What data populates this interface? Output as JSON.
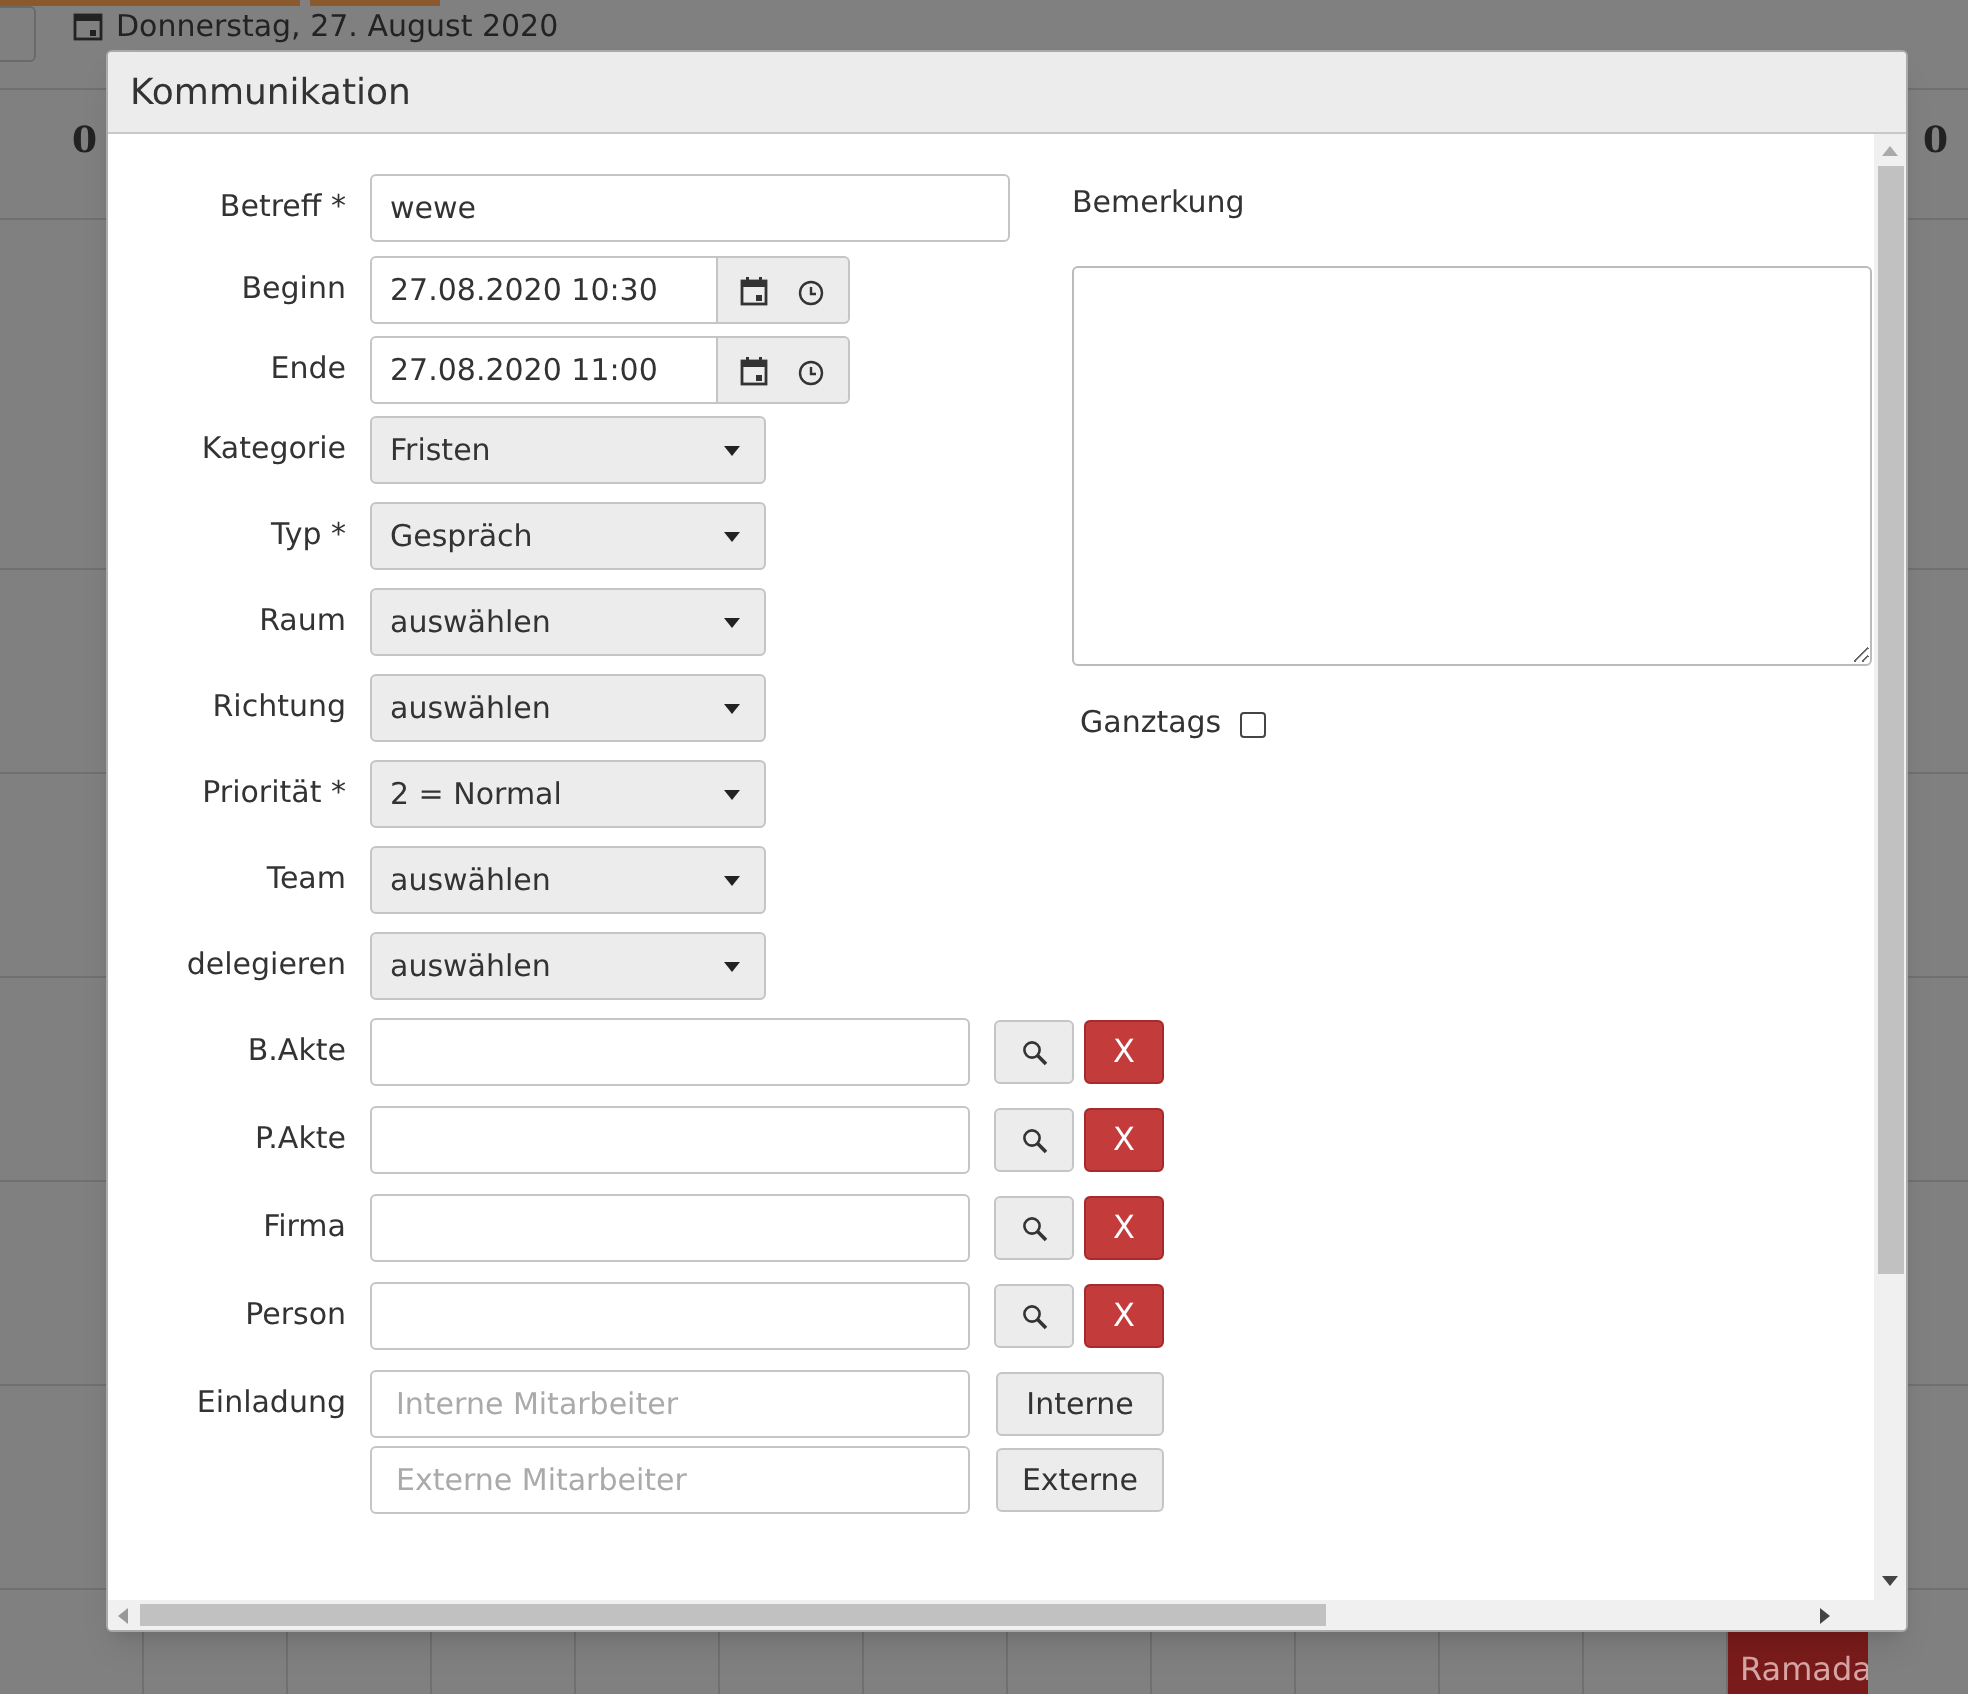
{
  "background": {
    "date": "Donnerstag, 27. August 2020",
    "column_headers": [
      "0",
      "0"
    ],
    "event": "Ramada"
  },
  "dialog": {
    "title": "Kommunikation",
    "fields": [
      {
        "kind": "text",
        "label": "Betreff *",
        "value": "wewe"
      },
      {
        "kind": "datetime",
        "label": "Beginn",
        "value": "27.08.2020 10:30"
      },
      {
        "kind": "datetime",
        "label": "Ende",
        "value": "27.08.2020 11:00"
      },
      {
        "kind": "select",
        "label": "Kategorie",
        "value": "Fristen"
      },
      {
        "kind": "select",
        "label": "Typ *",
        "value": "Gespräch"
      },
      {
        "kind": "select",
        "label": "Raum",
        "value": "auswählen"
      },
      {
        "kind": "select",
        "label": "Richtung",
        "value": "auswählen"
      },
      {
        "kind": "select",
        "label": "Priorität *",
        "value": "2 = Normal"
      },
      {
        "kind": "select",
        "label": "Team",
        "value": "auswählen"
      },
      {
        "kind": "select",
        "label": "delegieren",
        "value": "auswählen"
      },
      {
        "kind": "lookup",
        "label": "B.Akte",
        "clear": "X"
      },
      {
        "kind": "lookup",
        "label": "P.Akte",
        "clear": "X"
      },
      {
        "kind": "lookup",
        "label": "Firma",
        "clear": "X"
      },
      {
        "kind": "lookup",
        "label": "Person",
        "clear": "X"
      },
      {
        "kind": "invite",
        "label": "Einladung",
        "rows": [
          {
            "placeholder": "Interne Mitarbeiter",
            "button": "Interne"
          },
          {
            "placeholder": "Externe Mitarbeiter",
            "button": "Externe"
          }
        ]
      }
    ],
    "remark": {
      "label": "Bemerkung"
    },
    "allday": {
      "label": "Ganztags",
      "checked": false
    }
  }
}
